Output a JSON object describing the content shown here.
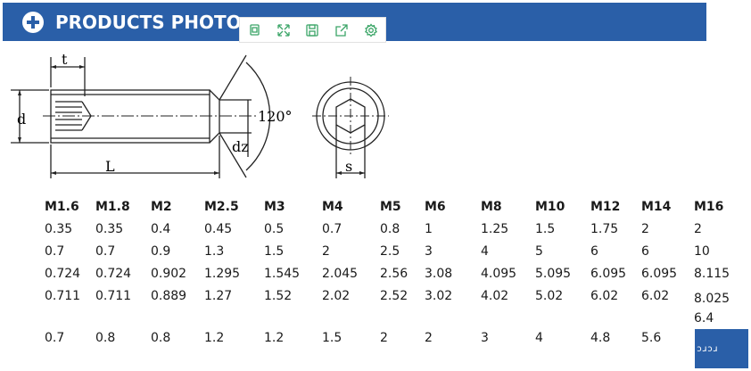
{
  "header": {
    "title": "PRODUCTS PHOTO"
  },
  "toolbar": {
    "buttons": [
      "copy-icon",
      "expand-icon",
      "save-icon",
      "share-icon",
      "settings-icon"
    ],
    "icon_color": "#3aa567"
  },
  "drawing": {
    "labels": {
      "t": "t",
      "d": "d",
      "L": "L",
      "angle": "120°",
      "dz": "dz",
      "s": "s"
    }
  },
  "table": {
    "sizes": [
      "M1.6",
      "M1.8",
      "M2",
      "M2.5",
      "M3",
      "M4",
      "M5",
      "M6",
      "M8",
      "M10",
      "M12",
      "M14",
      "M16"
    ],
    "rows": [
      [
        "0.35",
        "0.35",
        "0.4",
        "0.45",
        "0.5",
        "0.7",
        "0.8",
        "1",
        "1.25",
        "1.5",
        "1.75",
        "2",
        "2"
      ],
      [
        "0.7",
        "0.7",
        "0.9",
        "1.3",
        "1.5",
        "2",
        "2.5",
        "3",
        "4",
        "5",
        "6",
        "6",
        "10"
      ],
      [
        "0.724",
        "0.724",
        "0.902",
        "1.295",
        "1.545",
        "2.045",
        "2.56",
        "3.08",
        "4.095",
        "5.095",
        "6.095",
        "6.095",
        "8.115"
      ],
      [
        "0.711",
        "0.711",
        "0.889",
        "1.27",
        "1.52",
        "2.02",
        "2.52",
        "3.02",
        "4.02",
        "5.02",
        "6.02",
        "6.02",
        "8.025"
      ]
    ],
    "last_row": [
      "0.7",
      "0.8",
      "0.8",
      "1.2",
      "1.2",
      "1.5",
      "2",
      "2",
      "3",
      "4",
      "4.8",
      "5.6",
      ""
    ],
    "extra_value": "6.4"
  },
  "corner_badge": {
    "text": "ɔɹɔɹ"
  },
  "colors": {
    "brand_blue": "#2a5fa8",
    "text": "#1a1a1a"
  }
}
